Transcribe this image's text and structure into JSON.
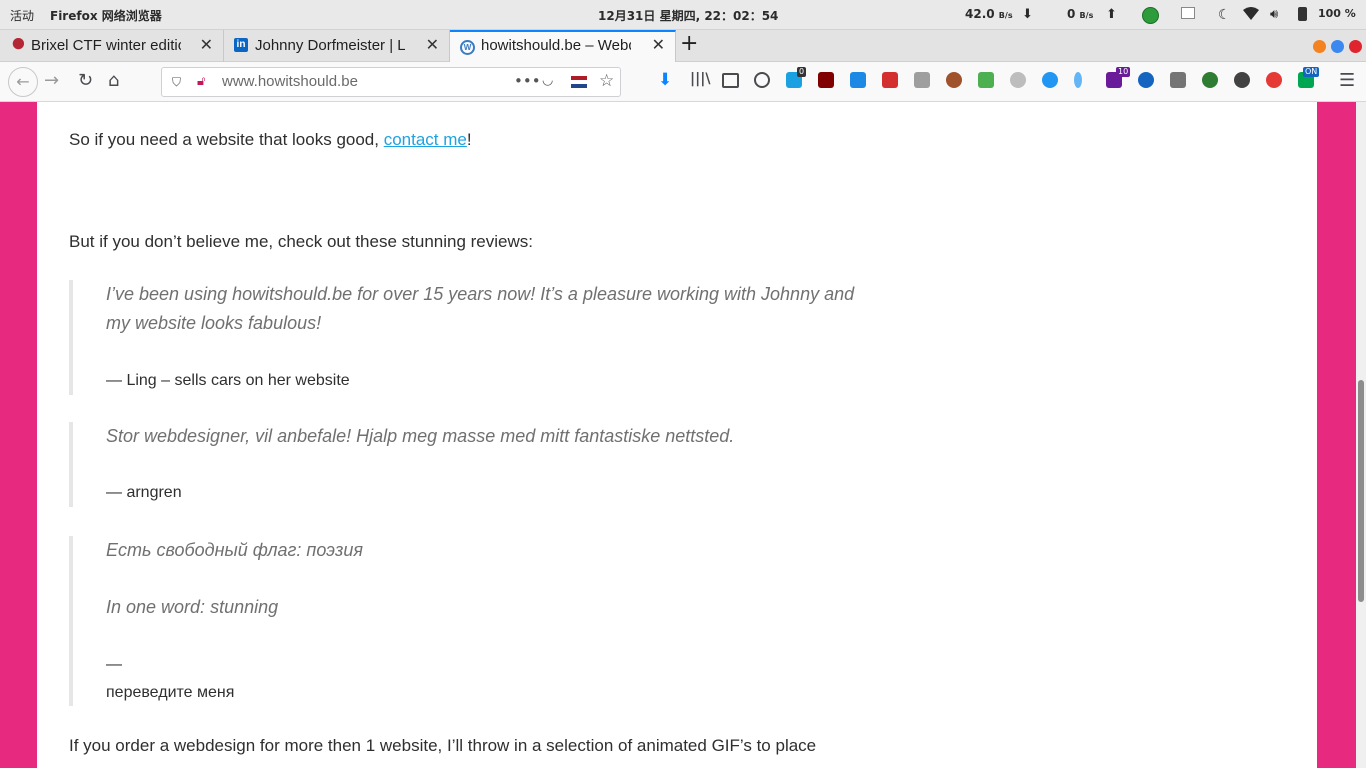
{
  "system_bar": {
    "activities": "活动",
    "app_menu": "Firefox 网络浏览器",
    "clock": "12月31日 星期四, 22：02：54",
    "net_down_value": "42.0",
    "net_down_unit": "B/s",
    "net_up_value": "0",
    "net_up_unit": "B/s",
    "battery": "100 %"
  },
  "tabs": [
    {
      "title": "Brixel CTF winter edition",
      "icon": "brixel-favicon"
    },
    {
      "title": "Johnny Dorfmeister | LinkedIn",
      "icon": "linkedin-favicon",
      "icon_text": "in"
    },
    {
      "title": "howitshould.be – Webdesign",
      "icon": "wordpress-favicon",
      "icon_text": "W",
      "active": true
    }
  ],
  "toolbar": {
    "url": "www.howitshould.be",
    "badge_extension_1": "0",
    "badge_extension_2": "10",
    "badge_extension_3": "ON"
  },
  "colors": {
    "page_border": "#e72a7f",
    "link": "#1fa3e0",
    "active_tab_accent": "#0a84ff"
  },
  "content": {
    "contact_prefix": "So if you need a website that looks good, ",
    "contact_link": "contact me",
    "contact_suffix": "!",
    "reviews_intro": "But if you don’t believe me, check out these stunning reviews:",
    "quotes": [
      {
        "text": "I’ve been using howitshould.be for over 15 years now! It’s a pleasure working with Johnny and my website looks fabulous!",
        "cite": "— Ling – sells cars on her website"
      },
      {
        "text": "Stor webdesigner, vil anbefale! Hjalp meg masse med mitt fantastiske nettsted.",
        "cite": "— arngren"
      },
      {
        "text_1": "Есть свободный флаг: поэзия",
        "text_2": "In one word: stunning",
        "cite_dash": "—",
        "cite_name": "переведите меня"
      }
    ],
    "order_paragraph": "If you order a webdesign for more then 1 website, I’ll throw in a selection of animated GIF’s to place"
  }
}
